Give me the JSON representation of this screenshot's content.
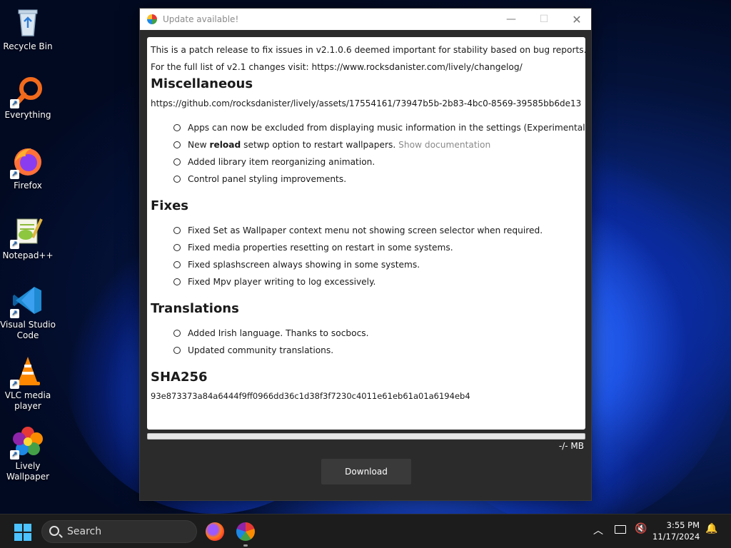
{
  "desktop": {
    "icons": [
      {
        "label": "Recycle Bin"
      },
      {
        "label": "Everything"
      },
      {
        "label": "Firefox"
      },
      {
        "label": "Notepad++"
      },
      {
        "label": "Visual Studio Code"
      },
      {
        "label": "VLC media player"
      },
      {
        "label": "Lively Wallpaper"
      }
    ]
  },
  "window": {
    "title": "Update available!",
    "intro_line": "This is a patch release to fix issues in v2.1.0.6 deemed important for stability based on bug reports.",
    "changes_line": "For the full list of v2.1 changes visit: https://www.rocksdanister.com/lively/changelog/",
    "misc": {
      "heading": "Miscellaneous",
      "link": "https://github.com/rocksdanister/lively/assets/17554161/73947b5b-2b83-4bc0-8569-39585bb6de13",
      "items": [
        "Apps can now be excluded from displaying music information in the settings (Experimental.)",
        "Added library item reorganizing animation.",
        "Control panel styling improvements."
      ],
      "reload_item": {
        "prefix": "New ",
        "bold": "reload",
        "suffix": " setwp option to restart wallpapers. ",
        "link": "Show documentation"
      }
    },
    "fixes": {
      "heading": "Fixes",
      "items": [
        "Fixed Set as Wallpaper context menu not showing screen selector when required.",
        "Fixed media properties resetting on restart in some systems.",
        "Fixed splashscreen always showing in some systems.",
        "Fixed Mpv player writing to log excessively."
      ]
    },
    "translations": {
      "heading": "Translations",
      "items": [
        "Added Irish language. Thanks to socbocs.",
        "Updated community translations."
      ]
    },
    "sha": {
      "heading": "SHA256",
      "value": "93e873373a84a6444f9ff0966dd36c1d38f3f7230c4011e61eb61a01a6194eb4"
    },
    "progress": 0,
    "size_text": "-/- MB",
    "download_label": "Download"
  },
  "taskbar": {
    "search_placeholder": "Search",
    "time": "3:55 PM",
    "date": "11/17/2024"
  }
}
